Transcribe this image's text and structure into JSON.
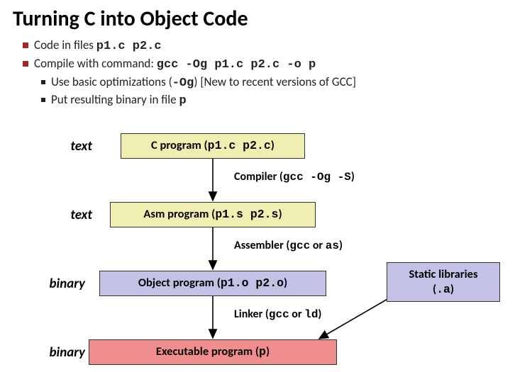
{
  "title": "Turning C into Object Code",
  "bullets": {
    "l1a_pre": "Code in files ",
    "l1a_code": "p1.c p2.c",
    "l1b_pre": "Compile with command: ",
    "l1b_code": "gcc -Og p1.c p2.c -o p",
    "l2a_pre": "Use basic optimizations (",
    "l2a_code": "-Og",
    "l2a_post": ") [New to recent versions of GCC]",
    "l2b_pre": "Put resulting binary in file ",
    "l2b_code": "p"
  },
  "labels": {
    "text": "text",
    "binary": "binary"
  },
  "boxes": {
    "cprog_pre": "C program (",
    "cprog_code": "p1.c p2.c",
    "cprog_post": ")",
    "asm_pre": "Asm program (",
    "asm_code": "p1.s p2.s",
    "asm_post": ")",
    "obj_pre": "Object program (",
    "obj_code": "p1.o p2.o",
    "obj_post": ")",
    "exe_pre": "Executable program (",
    "exe_code": "p",
    "exe_post": ")",
    "lib_line1": "Static libraries",
    "lib_line2_pre": "(",
    "lib_line2_code": ".a",
    "lib_line2_post": ")"
  },
  "steps": {
    "compiler_pre": "Compiler (",
    "compiler_code": "gcc -Og -S",
    "compiler_post": ")",
    "assembler_pre": "Assembler (",
    "assembler_code1": "gcc",
    "assembler_mid": " or ",
    "assembler_code2": "as",
    "assembler_post": ")",
    "linker_pre": "Linker (",
    "linker_code1": "gcc",
    "linker_mid": " or ",
    "linker_code2": "ld",
    "linker_post": ")"
  }
}
